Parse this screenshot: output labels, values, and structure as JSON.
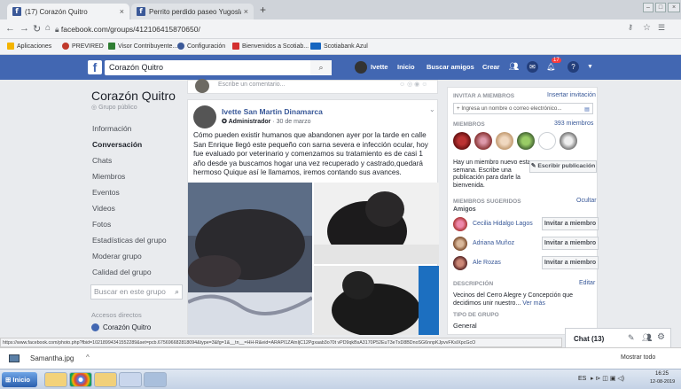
{
  "browser": {
    "tabs": [
      {
        "label": "(17) Corazón Quitro",
        "active": true
      },
      {
        "label": "Perrito perdido paseo Yugoslavo - Fo",
        "active": false
      }
    ],
    "new_tab": "+",
    "url": "facebook.com/groups/412106415870650/",
    "bookmarks": [
      {
        "label": "Aplicaciones",
        "color": "#f4b400"
      },
      {
        "label": "PREVIRED",
        "color": "#c0392b"
      },
      {
        "label": "Visor Contribuyente...",
        "color": "#2e7d32"
      },
      {
        "label": "Configuración",
        "color": "#3b5998"
      },
      {
        "label": "Bienvenidos a Scotiab...",
        "color": "#d32f2f"
      },
      {
        "label": "Scotiabank Azul",
        "color": "#1565c0"
      }
    ]
  },
  "fb_header": {
    "search_value": "Corazón Quitro",
    "user": "Ivette",
    "nav": [
      "Inicio",
      "Buscar amigos",
      "Crear"
    ],
    "notif_badge": "17"
  },
  "group": {
    "name": "Corazón Quitro",
    "privacy": "Grupo público",
    "nav": [
      {
        "label": "Información",
        "active": false
      },
      {
        "label": "Conversación",
        "active": true
      },
      {
        "label": "Chats",
        "active": false
      },
      {
        "label": "Miembros",
        "active": false
      },
      {
        "label": "Eventos",
        "active": false
      },
      {
        "label": "Videos",
        "active": false
      },
      {
        "label": "Fotos",
        "active": false
      },
      {
        "label": "Estadísticas del grupo",
        "active": false
      },
      {
        "label": "Moderar grupo",
        "active": false
      },
      {
        "label": "Calidad del grupo",
        "active": false
      }
    ],
    "search_placeholder": "Buscar en este grupo",
    "shortcuts_title": "Accesos directos",
    "shortcut_item": "Corazón Quitro"
  },
  "post": {
    "comment_placeholder": "Escribe un comentario...",
    "author": "Ivette San Martin Dinamarca",
    "role": "Administrador",
    "date": "30 de marzo",
    "text": "Cómo pueden existir humanos que abandonen ayer por la tarde en calle San Enrique llegó este pequeño con sarna severa e infección ocular, hoy fue evaluado por veterinario y comenzamos su tratamiento es de casi 1 año desde ya buscamos hogar una vez recuperado y castrado,quedará hermoso Quique así le llamamos, iremos contando sus avances."
  },
  "right": {
    "invite_title": "INVITAR A MIEMBROS",
    "invite_link": "Insertar invitación",
    "invite_placeholder": "+ Ingresa un nombre o correo electrónico...",
    "members_title": "MIEMBROS",
    "members_count": "393 miembros",
    "new_member_text": "Hay un miembro nuevo esta semana. Escribe una publicación para darle la bienvenida.",
    "write_post_button": "Escribir publicación",
    "suggested_title": "MIEMBROS SUGERIDOS",
    "hide_link": "Ocultar",
    "friends_label": "Amigos",
    "suggested": [
      {
        "name": "Cecilia Hidalgo Lagos",
        "button": "Invitar a miembro"
      },
      {
        "name": "Adriana Muñoz",
        "button": "Invitar a miembro"
      },
      {
        "name": "Ale Rozas",
        "button": "Invitar a miembro"
      }
    ],
    "description_title": "DESCRIPCIÓN",
    "edit_link": "Editar",
    "description_text": "Vecinos del Cerro Alegre y Concepción que decidimos unir nuestro...",
    "see_more": "Ver más",
    "group_type_title": "TIPO DE GRUPO",
    "group_type": "General"
  },
  "chat": {
    "label": "Chat (13)"
  },
  "status_url": "https://www.facebook.com/photo.php?fbid=10218994341552289&set=pcb.675696682818094&type=3&fg=1&__tn__=HH-R&eid=ARAPI1ZAtnIjC12Pgxaab3o70t vPD9qkBsA3170P52EuT3eTxD8BDnoSG6nnpKJpvvFKsIXpcGcO",
  "download": {
    "file": "Samantha.jpg",
    "show_all": "Mostrar todo"
  },
  "taskbar": {
    "start": "Inicio",
    "lang": "ES",
    "time": "16:25",
    "date": "12-08-2019"
  }
}
